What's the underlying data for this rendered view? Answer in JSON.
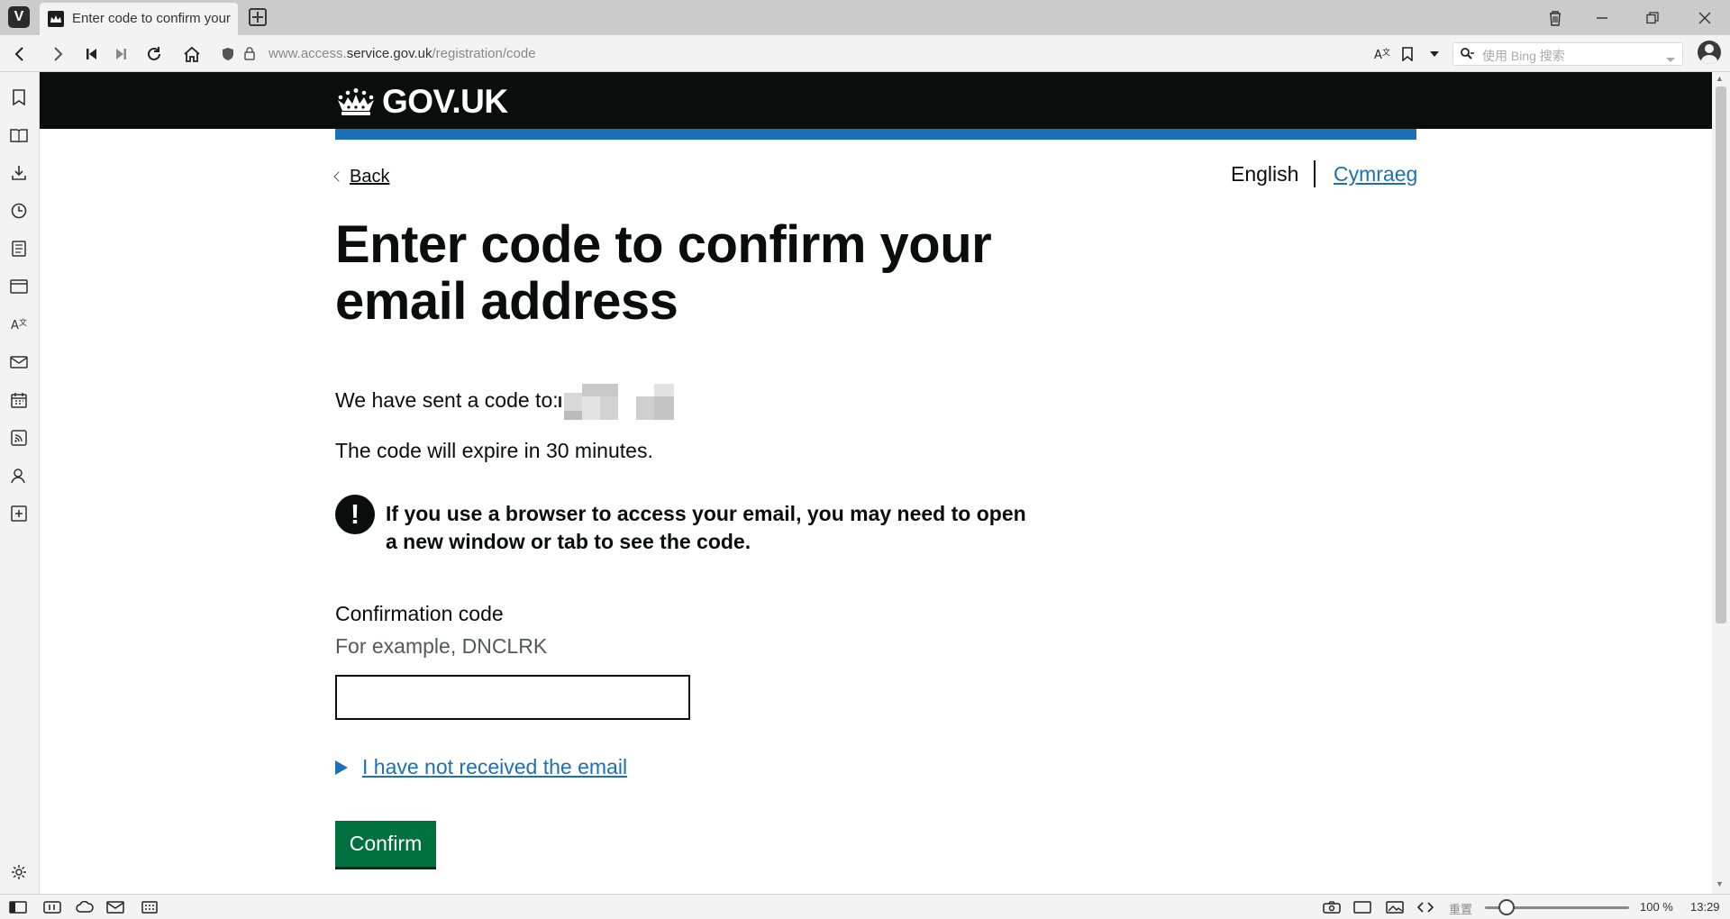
{
  "browser": {
    "tab_title": "Enter code to confirm your",
    "url_prefix": "www.access.",
    "url_domain": "service.gov.uk",
    "url_path": "/registration/code",
    "search_placeholder": "使用 Bing 搜索",
    "zoom_label": "重置",
    "zoom_level": "100 %",
    "clock": "13:29",
    "zoom_fraction": 0.15
  },
  "header": {
    "brand": "GOV.UK"
  },
  "nav": {
    "back": "Back",
    "lang_current": "English",
    "lang_other": "Cymraeg"
  },
  "main": {
    "heading": "Enter code to confirm your email address",
    "sent_to": "We have sent a code to:",
    "expire": "The code will expire in 30 minutes.",
    "warning_icon": "!",
    "warning": "If you use a browser to access your email, you may need to open a new window or tab to see the code.",
    "code_label": "Confirmation code",
    "code_hint": "For example, DNCLRK",
    "code_value": "",
    "not_received": "I have not received the email",
    "confirm": "Confirm"
  },
  "colors": {
    "gov_black": "#0b0c0c",
    "gov_blue": "#1d70b8",
    "gov_green": "#00703c",
    "hint_grey": "#505a5f"
  }
}
